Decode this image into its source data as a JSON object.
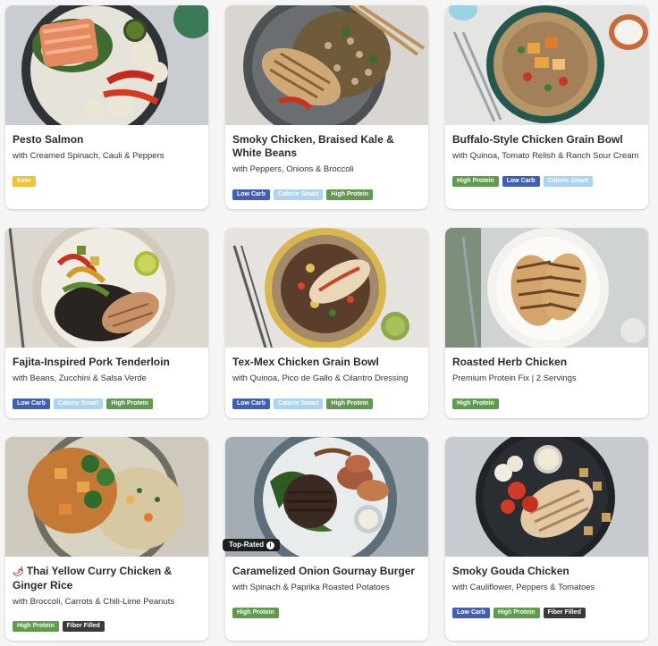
{
  "tag_colors": {
    "Keto": "#f0c23a",
    "Low Carb": "#3f5fb8",
    "Calorie Smart": "#a9d4f2",
    "High Protein": "#5f9a4e",
    "Fiber Filled": "#3a3a3a"
  },
  "cards": [
    {
      "title": "Pesto Salmon",
      "subtitle": "with Creamed Spinach, Cauli & Peppers",
      "tags": [
        "Keto"
      ]
    },
    {
      "title": "Smoky Chicken, Braised Kale & White Beans",
      "subtitle": "with Peppers, Onions & Broccoli",
      "tags": [
        "Low Carb",
        "Calorie Smart",
        "High Protein"
      ]
    },
    {
      "title": "Buffalo-Style Chicken Grain Bowl",
      "subtitle": "with Quinoa, Tomato Relish & Ranch Sour Cream",
      "tags": [
        "High Protein",
        "Low Carb",
        "Calorie Smart"
      ]
    },
    {
      "title": "Fajita-Inspired Pork Tenderloin",
      "subtitle": "with Beans, Zucchini & Salsa Verde",
      "tags": [
        "Low Carb",
        "Calorie Smart",
        "High Protein"
      ]
    },
    {
      "title": "Tex-Mex Chicken Grain Bowl",
      "subtitle": "with Quinoa, Pico de Gallo & Cilantro Dressing",
      "tags": [
        "Low Carb",
        "Calorie Smart",
        "High Protein"
      ]
    },
    {
      "title": "Roasted Herb Chicken",
      "subtitle": "Premium Protein Fix | 2 Servings",
      "tags": [
        "High Protein"
      ]
    },
    {
      "title": "Thai Yellow Curry Chicken & Ginger Rice",
      "subtitle": "with Broccoli, Carrots & Chili-Lime Peanuts",
      "tags": [
        "High Protein",
        "Fiber Filled"
      ],
      "spicy": true
    },
    {
      "title": "Caramelized Onion Gournay Burger",
      "subtitle": "with Spinach & Paprika Roasted Potatoes",
      "tags": [
        "High Protein"
      ],
      "badge": "Top-Rated"
    },
    {
      "title": "Smoky Gouda Chicken",
      "subtitle": "with Cauliflower, Peppers & Tomatoes",
      "tags": [
        "Low Carb",
        "High Protein",
        "Fiber Filled"
      ]
    }
  ]
}
